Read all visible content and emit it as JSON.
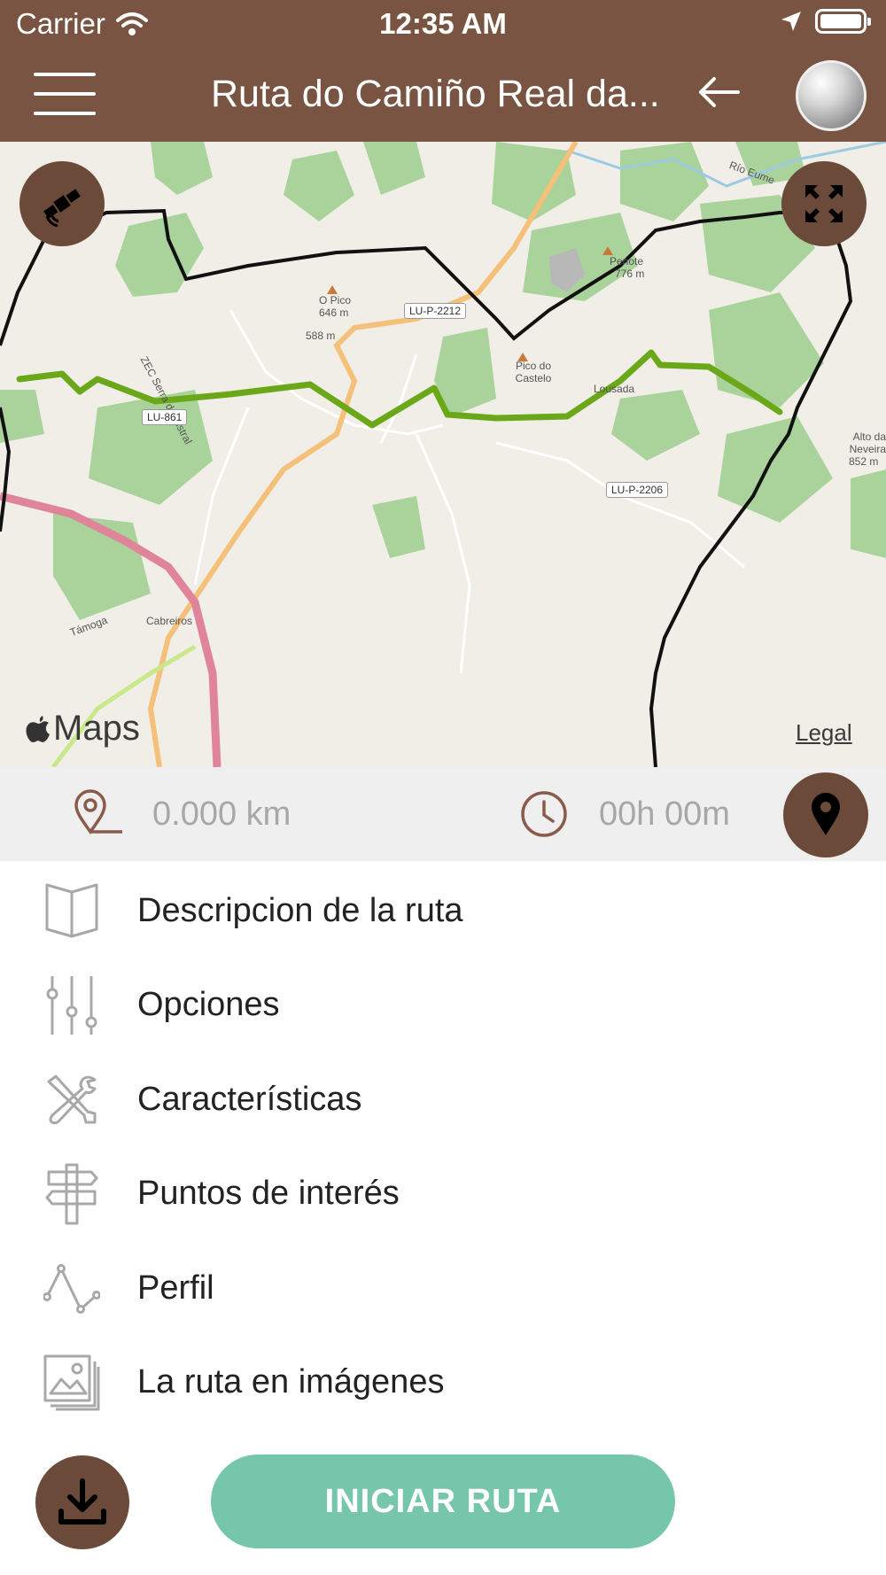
{
  "status_bar": {
    "carrier": "Carrier",
    "time": "12:35 AM"
  },
  "header": {
    "title": "Ruta do Camiño Real da..."
  },
  "map": {
    "attribution_logo": "Maps",
    "legal_label": "Legal",
    "labels": {
      "o_pico": "O Pico",
      "o_pico_elev": "646 m",
      "elev_588": "588 m",
      "pico_do_castelo": "Pico do Castelo",
      "penote": "Penote",
      "penote_elev": "776 m",
      "lousada": "Lousada",
      "alto_neveira": "Alto da Neveira",
      "alto_neveira_elev": "852 m",
      "cabreiros": "Cabreiros",
      "zec": "ZEC Serra do Xistral",
      "tamoga": "Támoga",
      "rio_eume": "Río Eume"
    },
    "roads": {
      "lu_p_2212": "LU-P-2212",
      "lu_861": "LU-861",
      "lu_p_2206": "LU-P-2206"
    },
    "colors": {
      "route": "#6aa81a",
      "boundary": "#111111",
      "forest": "#a9d39a",
      "background": "#f0eee6"
    },
    "icons": {
      "satellite": "satellite-icon",
      "fullscreen": "expand-arrows-icon"
    }
  },
  "stats": {
    "distance": "0.000 km",
    "duration": "00h 00m",
    "icons": {
      "distance": "location-pin-outline-icon",
      "duration": "clock-icon",
      "locate": "map-pin-icon"
    }
  },
  "menu": [
    {
      "label": "Descripcion de la ruta",
      "icon": "open-book-icon"
    },
    {
      "label": "Opciones",
      "icon": "sliders-icon"
    },
    {
      "label": "Características",
      "icon": "tools-icon"
    },
    {
      "label": "Puntos de interés",
      "icon": "signpost-icon"
    },
    {
      "label": "Perfil",
      "icon": "elevation-profile-icon"
    },
    {
      "label": "La ruta en imágenes",
      "icon": "image-gallery-icon"
    }
  ],
  "actions": {
    "start_label": "INICIAR RUTA",
    "download_icon": "download-icon",
    "accent_color": "#75c6ab",
    "brand_color": "#7a5442"
  }
}
